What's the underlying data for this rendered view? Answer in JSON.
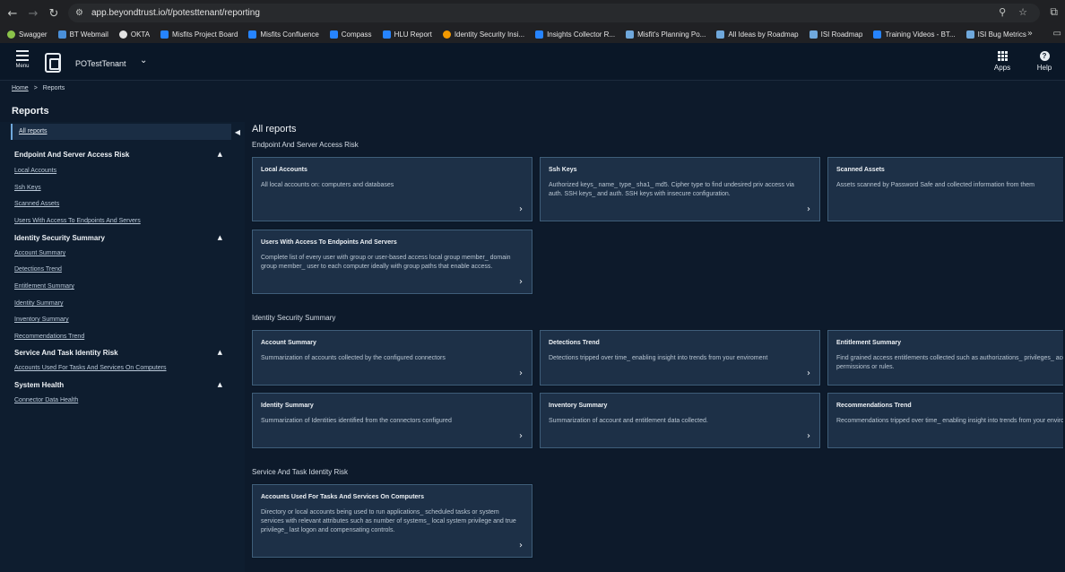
{
  "browser": {
    "url": "app.beyondtrust.io/t/potesttenant/reporting",
    "bookmarks": [
      {
        "label": "Swagger",
        "color": "#8bc34a"
      },
      {
        "label": "BT Webmail",
        "color": "#4a8fd8"
      },
      {
        "label": "OKTA",
        "color": "#e3e3e3"
      },
      {
        "label": "Misfits Project Board",
        "color": "#2684ff"
      },
      {
        "label": "Misfits Confluence",
        "color": "#2684ff"
      },
      {
        "label": "Compass",
        "color": "#2684ff"
      },
      {
        "label": "HLU Report",
        "color": "#2684ff"
      },
      {
        "label": "Identity Security Insi...",
        "color": "#f29900"
      },
      {
        "label": "Insights Collector R...",
        "color": "#2684ff"
      },
      {
        "label": "Misfit's Planning Po...",
        "color": "#6fa8dc"
      },
      {
        "label": "All Ideas by Roadmap",
        "color": "#6fa8dc"
      },
      {
        "label": "ISI Roadmap",
        "color": "#6fa8dc"
      },
      {
        "label": "Training Videos - BT...",
        "color": "#2684ff"
      },
      {
        "label": "ISI Bug Metrics",
        "color": "#6fa8dc"
      }
    ]
  },
  "header": {
    "menu_label": "Menu",
    "tenant": "POTestTenant",
    "apps_label": "Apps",
    "help_label": "Help"
  },
  "breadcrumb": {
    "home": "Home",
    "separator": ">",
    "current": "Reports"
  },
  "page_title": "Reports",
  "sidebar": {
    "all_reports": "All reports",
    "sections": [
      {
        "title": "Endpoint And Server Access Risk",
        "links": [
          "Local Accounts",
          "Ssh Keys",
          "Scanned Assets",
          "Users With Access To Endpoints And Servers"
        ]
      },
      {
        "title": "Identity Security Summary",
        "links": [
          "Account Summary",
          "Detections Trend",
          "Entitlement Summary",
          "Identity Summary",
          "Inventory Summary",
          "Recommendations Trend"
        ]
      },
      {
        "title": "Service And Task Identity Risk",
        "links": [
          "Accounts Used For Tasks And Services On Computers"
        ]
      },
      {
        "title": "System Health",
        "links": [
          "Connector Data Health"
        ]
      }
    ]
  },
  "main": {
    "title": "All reports",
    "sections": [
      {
        "title": "Endpoint And Server Access Risk",
        "cards": [
          {
            "title": "Local Accounts",
            "desc": "All local accounts on: computers and databases"
          },
          {
            "title": "Ssh Keys",
            "desc": "Authorized keys_ name_ type_ sha1_ md5. Cipher type to find undesired priv access via auth. SSH keys_ and auth. SSH keys with insecure configuration."
          },
          {
            "title": "Scanned Assets",
            "desc": "Assets scanned by Password Safe and collected information from them"
          },
          {
            "title": "Users With Access To Endpoints And Servers",
            "desc": "Complete list of every user with group or user-based access local group member_ domain group member_ user to each computer ideally with group paths that enable access."
          }
        ]
      },
      {
        "title": "Identity Security Summary",
        "cards": [
          {
            "title": "Account Summary",
            "desc": "Summarization of accounts collected by the configured connectors"
          },
          {
            "title": "Detections Trend",
            "desc": "Detections tripped over time_ enabling insight into trends from your enviroment"
          },
          {
            "title": "Entitlement Summary",
            "desc": "Find grained access entitlements collected such as authorizations_ privileges_ access rights_ permissions or rules."
          },
          {
            "title": "Identity Summary",
            "desc": "Summarization of Identities identified from the connectors configured"
          },
          {
            "title": "Inventory Summary",
            "desc": "Summarization of account and entitlement data collected."
          },
          {
            "title": "Recommendations Trend",
            "desc": "Recommendations tripped over time_ enabling insight into trends from your enviroment"
          }
        ]
      },
      {
        "title": "Service And Task Identity Risk",
        "cards": [
          {
            "title": "Accounts Used For Tasks And Services On Computers",
            "desc": "Directory or local accounts being used to run applications_ scheduled tasks or system services with relevant attributes such as number of systems_ local system privilege and true privilege_ last logon and compensating controls."
          }
        ]
      }
    ]
  }
}
